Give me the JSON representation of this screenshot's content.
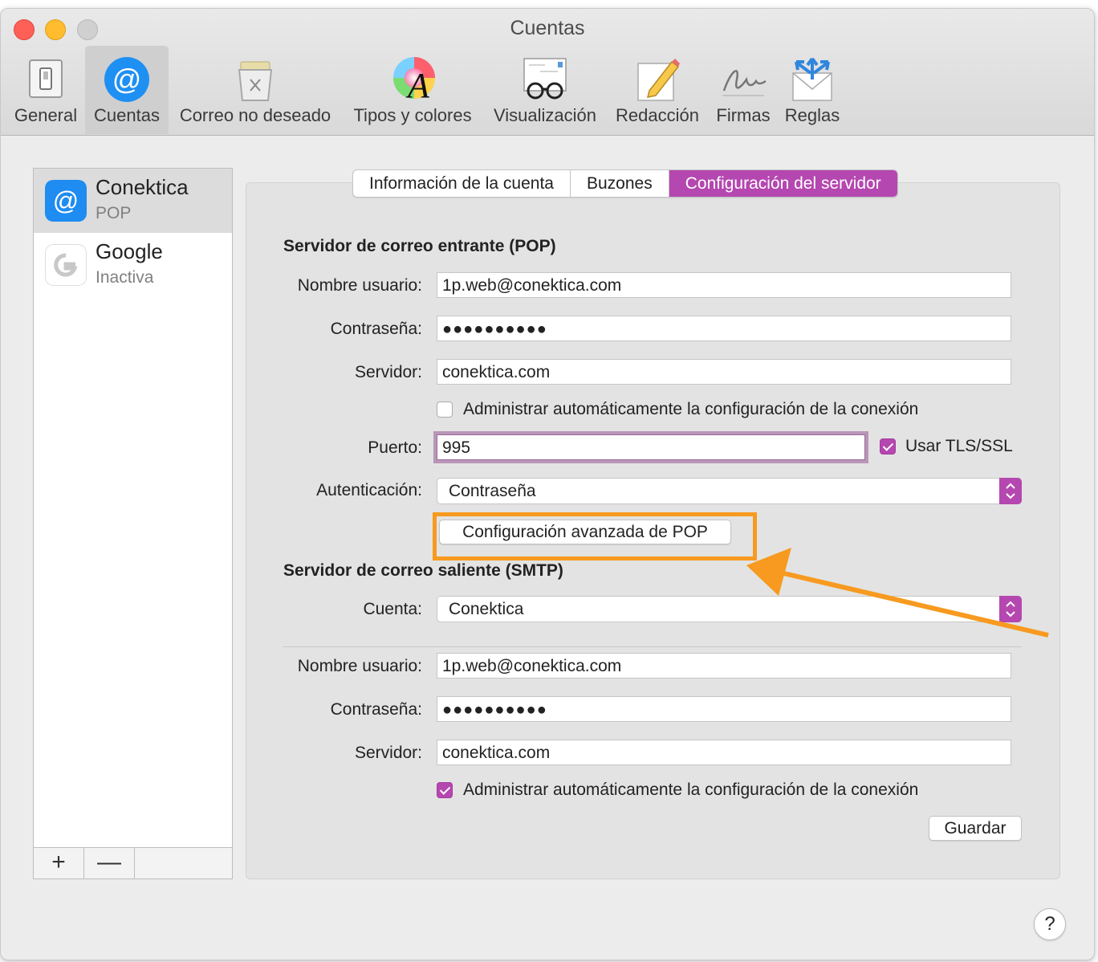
{
  "window": {
    "title": "Cuentas"
  },
  "toolbar": {
    "items": [
      {
        "label": "General",
        "icon": "switch-icon"
      },
      {
        "label": "Cuentas",
        "icon": "at-sign-icon"
      },
      {
        "label": "Correo no deseado",
        "icon": "trash-bin-icon"
      },
      {
        "label": "Tipos y colores",
        "icon": "color-wheel-icon"
      },
      {
        "label": "Visualización",
        "icon": "glasses-letter-icon"
      },
      {
        "label": "Redacción",
        "icon": "pencil-paper-icon"
      },
      {
        "label": "Firmas",
        "icon": "signature-icon"
      },
      {
        "label": "Reglas",
        "icon": "envelope-arrows-icon"
      }
    ],
    "active": "Cuentas"
  },
  "sidebar": {
    "accounts": [
      {
        "name": "Conektica",
        "status": "POP",
        "icon": "at-sign-icon",
        "selected": true
      },
      {
        "name": "Google",
        "status": "Inactiva",
        "icon": "google-icon",
        "selected": false
      }
    ],
    "add_label": "+",
    "remove_label": "—"
  },
  "tabs": [
    {
      "label": "Información de la cuenta",
      "active": false
    },
    {
      "label": "Buzones",
      "active": false
    },
    {
      "label": "Configuración del servidor",
      "active": true
    }
  ],
  "incoming": {
    "section_title": "Servidor de correo entrante (POP)",
    "username_label": "Nombre usuario:",
    "username": "1p.web@conektica.com",
    "password_label": "Contraseña:",
    "password": "●●●●●●●●●●",
    "server_label": "Servidor:",
    "server": "conektica.com",
    "auto_manage_label": "Administrar automáticamente la configuración de la conexión",
    "auto_manage_checked": false,
    "port_label": "Puerto:",
    "port": "995",
    "tls_label": "Usar TLS/SSL",
    "tls_checked": true,
    "auth_label": "Autenticación:",
    "auth_value": "Contraseña",
    "advanced_button": "Configuración avanzada de POP"
  },
  "outgoing": {
    "section_title": "Servidor de correo saliente (SMTP)",
    "account_label": "Cuenta:",
    "account_value": "Conektica",
    "username_label": "Nombre usuario:",
    "username": "1p.web@conektica.com",
    "password_label": "Contraseña:",
    "password": "●●●●●●●●●●",
    "server_label": "Servidor:",
    "server": "conektica.com",
    "auto_manage_label": "Administrar automáticamente la configuración de la conexión",
    "auto_manage_checked": true,
    "save_button": "Guardar"
  },
  "help_label": "?",
  "colors": {
    "accent": "#b547b0",
    "annotation": "#f79a1f"
  }
}
